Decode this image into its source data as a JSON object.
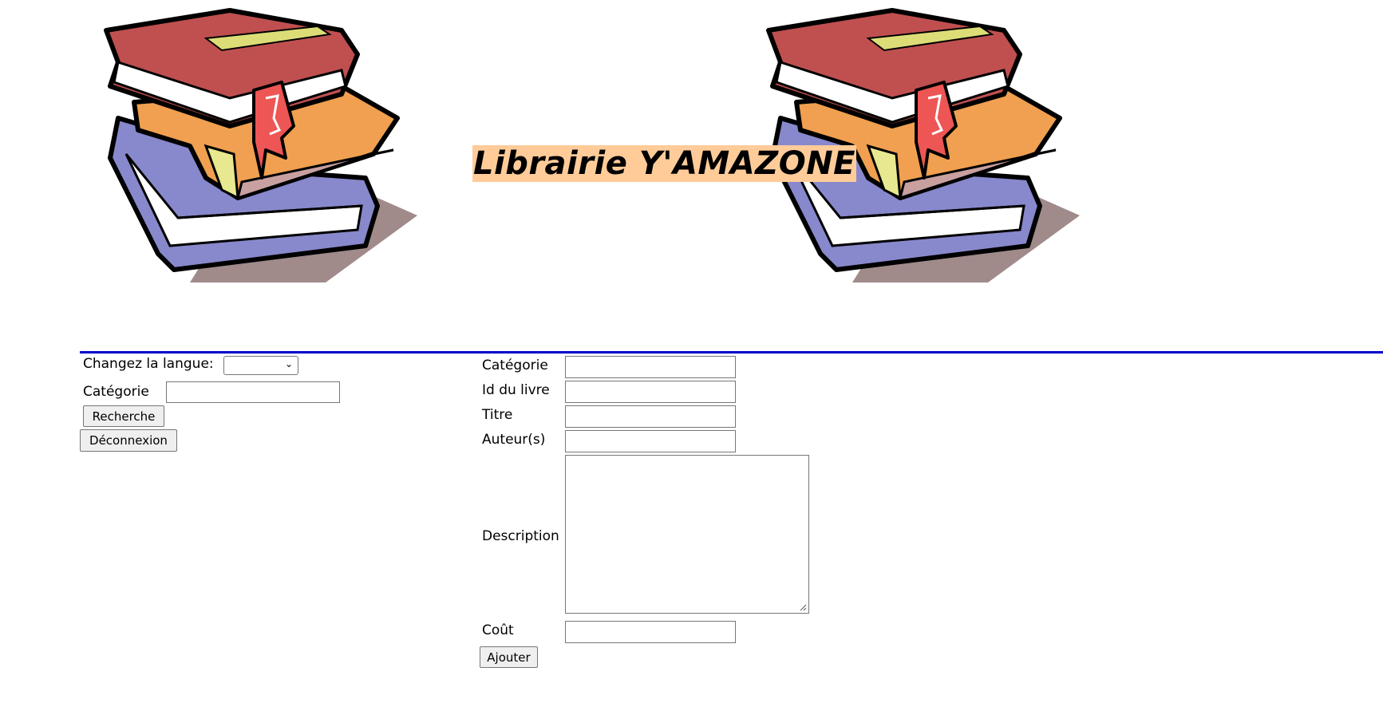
{
  "header": {
    "title": "Librairie Y'AMAZONE",
    "title_bg": "#ffcc99",
    "divider_color": "#0000cc"
  },
  "sidebar": {
    "language_label": "Changez la langue:",
    "language_selected": "",
    "category_label": "Catégorie",
    "category_value": "",
    "search_button": "Recherche",
    "logout_button": "Déconnexion"
  },
  "form": {
    "category_label": "Catégorie",
    "category_value": "",
    "book_id_label": "Id du livre",
    "book_id_value": "",
    "title_label": "Titre",
    "title_value": "",
    "authors_label": "Auteur(s)",
    "authors_value": "",
    "description_label": "Description",
    "description_value": "",
    "cost_label": "Coût",
    "cost_value": "",
    "add_button": "Ajouter"
  },
  "icons": {
    "books_left": "books-stack-illustration",
    "books_right": "books-stack-illustration",
    "select_chevron": "chevron-down-icon"
  }
}
